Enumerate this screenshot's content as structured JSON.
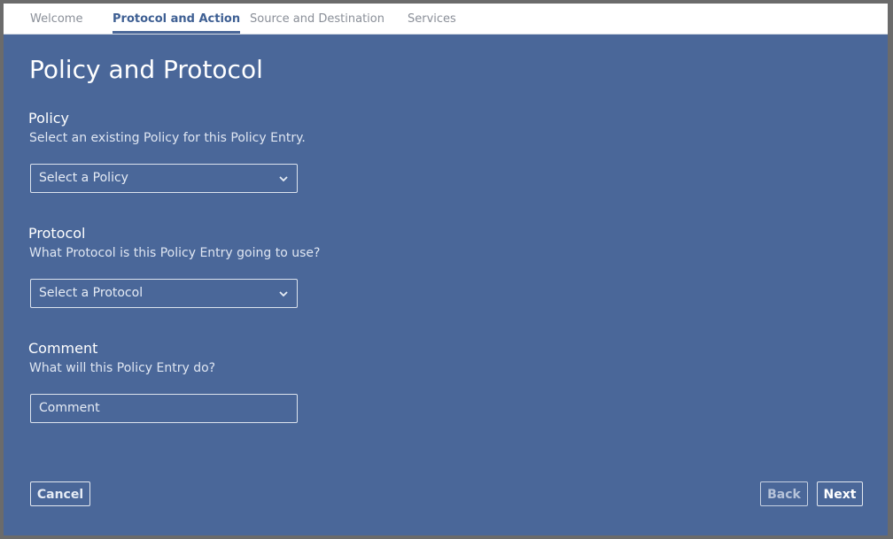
{
  "tabs": [
    {
      "label": "Welcome",
      "active": false
    },
    {
      "label": "Protocol and Action",
      "active": true
    },
    {
      "label": "Source and Destination",
      "active": false
    },
    {
      "label": "Services",
      "active": false
    }
  ],
  "title": "Policy and Protocol",
  "fields": {
    "policy": {
      "label": "Policy",
      "help": "Select an existing Policy for this Policy Entry.",
      "selected": "Select a Policy",
      "icon": "chevron-down-icon"
    },
    "protocol": {
      "label": "Protocol",
      "help": "What Protocol is this Policy Entry going to use?",
      "selected": "Select a Protocol",
      "icon": "chevron-down-icon"
    },
    "comment": {
      "label": "Comment",
      "help": "What will this Policy Entry do?",
      "placeholder": "Comment",
      "value": ""
    }
  },
  "buttons": {
    "cancel": "Cancel",
    "back": "Back",
    "next": "Next"
  },
  "colors": {
    "background": "#4a6799",
    "tabbar": "#ffffff",
    "tab_active": "#3e5f93",
    "tab_inactive": "#8a8f98"
  }
}
